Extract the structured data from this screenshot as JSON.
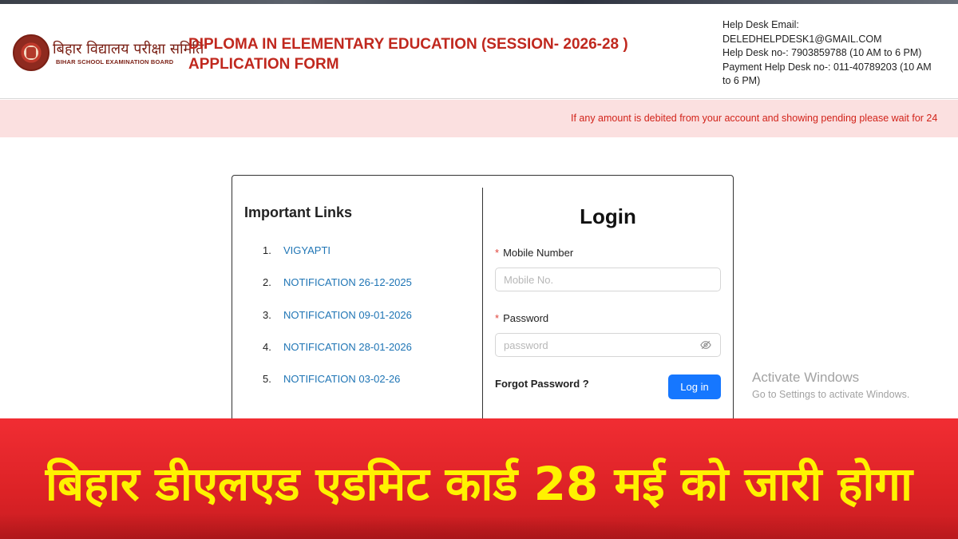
{
  "header": {
    "org_name_hindi": "बिहार विद्यालय परीक्षा समिति",
    "org_name_english": "BIHAR SCHOOL EXAMINATION BOARD",
    "title_line1": "DIPLOMA IN ELEMENTARY EDUCATION (SESSION- 2026-28 )",
    "title_line2": "APPLICATION FORM",
    "help": {
      "email_label": "Help Desk Email:",
      "email": "DELEDHELPDESK1@GMAIL.COM",
      "desk": "Help Desk no-: 7903859788 (10 AM to 6 PM)",
      "payment_line1": "Payment Help Desk no-: 011-40789203 (10 AM",
      "payment_line2": "to 6 PM)"
    }
  },
  "notice": {
    "text": "If any amount is debited from your account and showing pending please wait for 24"
  },
  "links": {
    "title": "Important Links",
    "items": [
      {
        "num": "1.",
        "label": "VIGYAPTI"
      },
      {
        "num": "2.",
        "label": "NOTIFICATION 26-12-2025"
      },
      {
        "num": "3.",
        "label": "NOTIFICATION 09-01-2026"
      },
      {
        "num": "4.",
        "label": "NOTIFICATION 28-01-2026"
      },
      {
        "num": "5.",
        "label": "NOTIFICATION 03-02-26"
      }
    ]
  },
  "login": {
    "title": "Login",
    "mobile_label": "Mobile Number",
    "mobile_placeholder": "Mobile No.",
    "mobile_value": "",
    "password_label": "Password",
    "password_placeholder": "password",
    "password_value": "",
    "forgot_label": "Forgot Password ?",
    "submit_label": "Log in",
    "required_mark": "*"
  },
  "watermark": {
    "line1": "Activate Windows",
    "line2": "Go to Settings to activate Windows."
  },
  "banner": {
    "headline": "बिहार डीएलएड एडमिट कार्ड 28 मई को जारी होगा"
  },
  "colors": {
    "title_red": "#c0281e",
    "notice_bg": "#fbe0e0",
    "link_blue": "#1f75b5",
    "primary_button": "#1677ff",
    "banner_red": "#e0262a",
    "headline_yellow": "#fff200"
  },
  "icons": {
    "logo": "board-seal-logo",
    "password_toggle": "eye-slash-icon"
  }
}
